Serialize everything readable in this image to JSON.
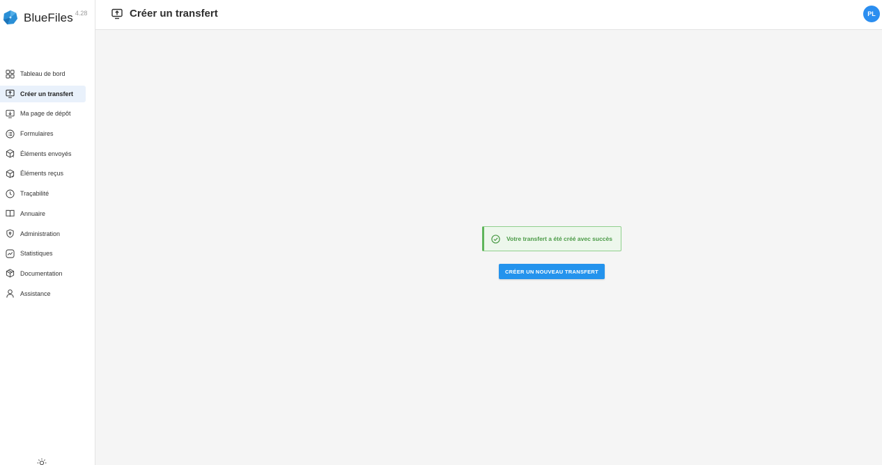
{
  "brand": {
    "name": "BlueFiles",
    "version": "4.28",
    "color": "#2a8fd6"
  },
  "header": {
    "title": "Créer un transfert",
    "icon": "upload-monitor-icon"
  },
  "user": {
    "initials": "PL",
    "avatar_color": "#2b8ef0"
  },
  "sidebar": {
    "items": [
      {
        "label": "Tableau de bord",
        "icon": "dashboard-grid-icon",
        "active": false
      },
      {
        "label": "Créer un transfert",
        "icon": "upload-monitor-icon",
        "active": true
      },
      {
        "label": "Ma page de dépôt",
        "icon": "download-monitor-icon",
        "active": false
      },
      {
        "label": "Formulaires",
        "icon": "form-list-icon",
        "active": false
      },
      {
        "label": "Éléments envoyés",
        "icon": "package-sent-icon",
        "active": false
      },
      {
        "label": "Éléments reçus",
        "icon": "package-received-icon",
        "active": false
      },
      {
        "label": "Traçabilité",
        "icon": "clock-icon",
        "active": false
      },
      {
        "label": "Annuaire",
        "icon": "book-icon",
        "active": false
      },
      {
        "label": "Administration",
        "icon": "shield-icon",
        "active": false
      },
      {
        "label": "Statistiques",
        "icon": "chart-line-icon",
        "active": false
      },
      {
        "label": "Documentation",
        "icon": "package-icon",
        "active": false
      },
      {
        "label": "Assistance",
        "icon": "person-icon",
        "active": false
      }
    ]
  },
  "main": {
    "alert": {
      "text": "Votre transfert a été créé avec succès",
      "icon": "check-circle-icon",
      "color": "#4a9a46"
    },
    "button_label": "CRÉER UN NOUVEAU TRANSFERT",
    "accent": "#2493ed"
  }
}
